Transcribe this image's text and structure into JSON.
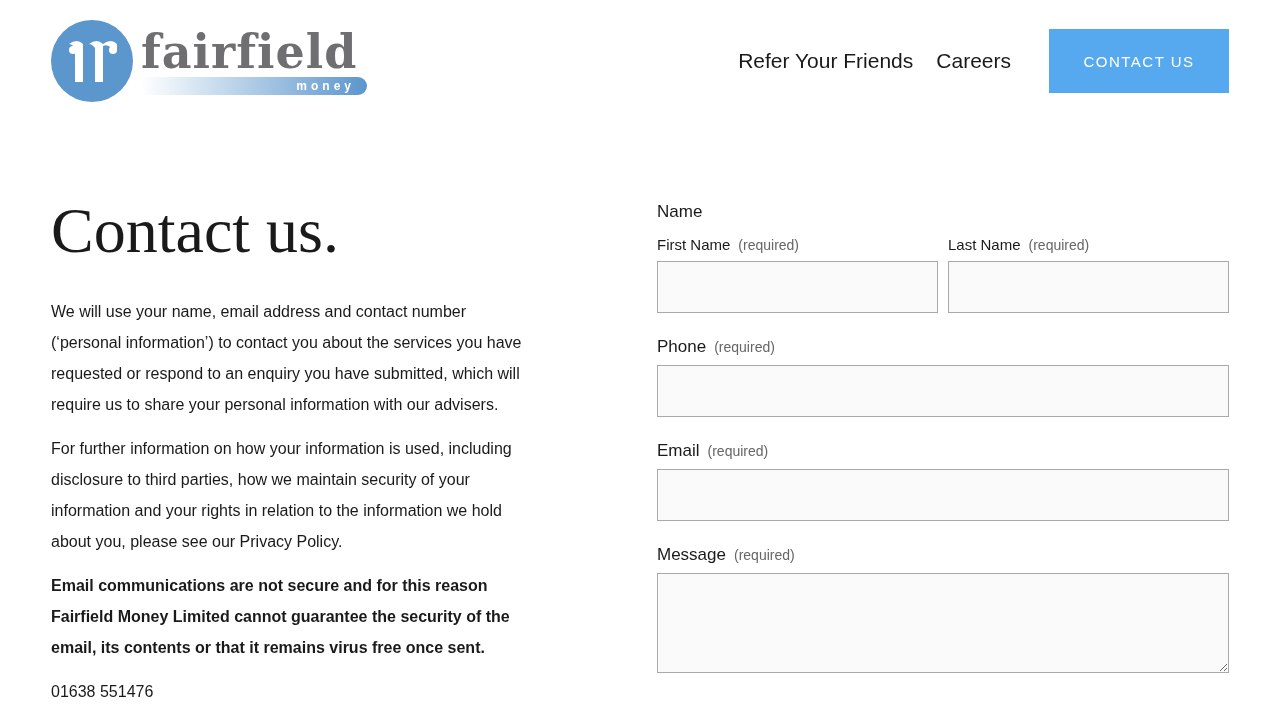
{
  "header": {
    "logo": {
      "wordmark": "fairfield",
      "tagline": "money"
    },
    "nav": [
      "Refer Your Friends",
      "Careers"
    ],
    "cta": "CONTACT US"
  },
  "intro": {
    "title": "Contact us.",
    "paragraphs": [
      {
        "text": "We will use your name, email address and contact number (‘personal information’) to contact you about the services you have requested or respond to an enquiry you have submitted, which will require us to share your personal information with our advisers.",
        "bold": false
      },
      {
        "text": "For further information on how your information is used, including disclosure to third parties, how we maintain security of your information and your rights in relation to the information we hold about you, please see our Privacy Policy.",
        "bold": false
      },
      {
        "text": "Email communications are not secure and for this reason Fairfield Money Limited cannot guarantee the security of the email, its contents or that it remains virus free once sent.",
        "bold": true
      }
    ],
    "phone": "01638 551476"
  },
  "form": {
    "group_label": "Name",
    "name_fields": [
      {
        "label": "First Name",
        "note": "(required)"
      },
      {
        "label": "Last Name",
        "note": "(required)"
      }
    ],
    "fields": [
      {
        "label": "Phone",
        "note": "(required)",
        "kind": "input"
      },
      {
        "label": "Email",
        "note": "(required)",
        "kind": "input"
      },
      {
        "label": "Message",
        "note": "(required)",
        "kind": "textarea"
      }
    ]
  }
}
